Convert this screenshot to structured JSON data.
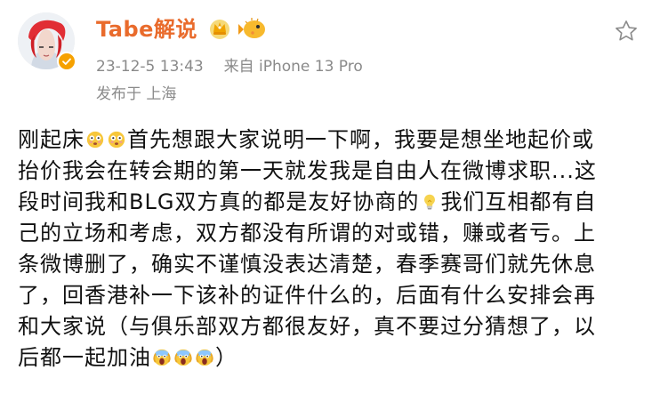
{
  "header": {
    "name": "Tabe解说",
    "timestamp": "23-12-5 13:43",
    "source_prefix": "来自",
    "device": "iPhone 13 Pro",
    "location": "发布于 上海",
    "more_icon": "star-outline-icon"
  },
  "post": {
    "lines": [
      {
        "parts": [
          {
            "type": "text",
            "value": "刚起床"
          },
          {
            "type": "emoji",
            "name": "flushed-face-emoji"
          },
          {
            "type": "emoji",
            "name": "flushed-face-emoji"
          },
          {
            "type": "text",
            "value": "首先想跟大家说明一下啊，我要是想坐地起价或"
          }
        ]
      },
      {
        "parts": [
          {
            "type": "text",
            "value": "抬价我会在转会期的第一天就发我是自由人在微博求职...这"
          }
        ]
      },
      {
        "parts": [
          {
            "type": "text",
            "value": "段时间我和BLG双方真的都是友好协商的"
          },
          {
            "type": "emoji",
            "name": "lightbulb-emoji"
          },
          {
            "type": "text",
            "value": "我们互相都有自"
          }
        ]
      },
      {
        "parts": [
          {
            "type": "text",
            "value": "己的立场和考虑，双方都没有所谓的对或错，赚或者亏。上"
          }
        ]
      },
      {
        "parts": [
          {
            "type": "text",
            "value": "条微博删了，确实不谨慎没表达清楚，春季赛哥们就先休息"
          }
        ]
      },
      {
        "parts": [
          {
            "type": "text",
            "value": "了，回香港补一下该补的证件什么的，后面有什么安排会再"
          }
        ]
      },
      {
        "parts": [
          {
            "type": "text",
            "value": "和大家说（与俱乐部双方都很友好，真不要过分猜想了，以"
          }
        ]
      },
      {
        "parts": [
          {
            "type": "text",
            "value": "后都一起加油"
          },
          {
            "type": "emoji",
            "name": "screaming-face-emoji"
          },
          {
            "type": "emoji",
            "name": "screaming-face-emoji"
          },
          {
            "type": "emoji",
            "name": "screaming-face-emoji"
          },
          {
            "type": "text",
            "value": "）"
          }
        ]
      }
    ]
  },
  "colors": {
    "name": "#e96b2c",
    "meta": "#8a8a8a",
    "body": "#111111",
    "badge": "#f6a100"
  }
}
